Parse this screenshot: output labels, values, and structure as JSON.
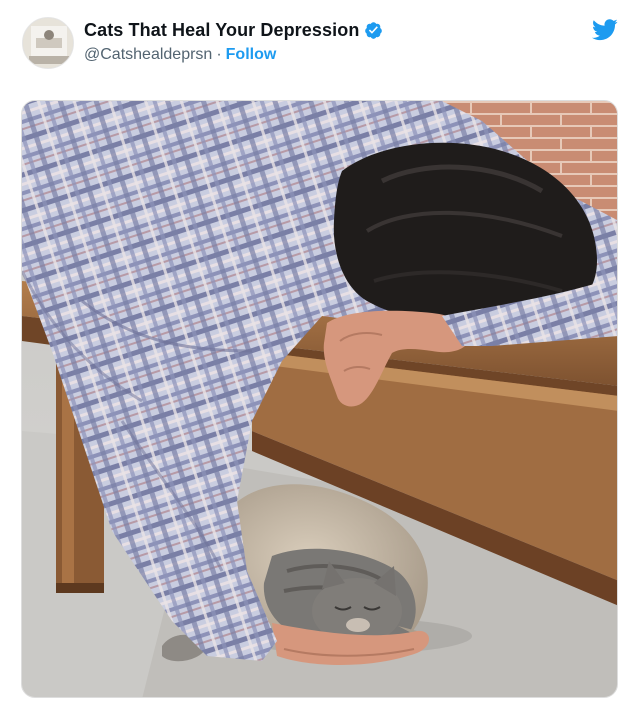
{
  "tweet": {
    "display_name": "Cats That Heal Your Depression",
    "handle": "@Catshealdeprsn",
    "separator": "·",
    "follow_label": "Follow",
    "verified": true
  },
  "icons": {
    "verified": "verified-badge-icon",
    "brand": "twitter-bird-icon"
  },
  "colors": {
    "accent": "#1d9bf0",
    "name": "#0f1419",
    "secondary": "#536471"
  }
}
